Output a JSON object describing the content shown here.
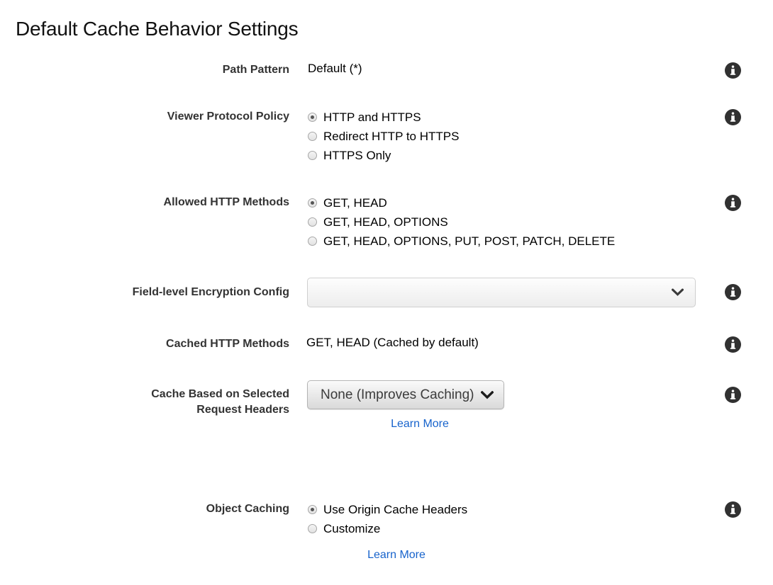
{
  "page": {
    "title": "Default Cache Behavior Settings",
    "accent_link_color": "#1763cc",
    "label_color": "#333333"
  },
  "icons": {
    "info": "info-icon",
    "chevron_down": "chevron-down-icon"
  },
  "rows": {
    "path_pattern": {
      "label": "Path Pattern",
      "value": "Default (*)"
    },
    "viewer_protocol_policy": {
      "label": "Viewer Protocol Policy",
      "options": [
        {
          "label": "HTTP and HTTPS",
          "selected": true
        },
        {
          "label": "Redirect HTTP to HTTPS",
          "selected": false
        },
        {
          "label": "HTTPS Only",
          "selected": false
        }
      ]
    },
    "allowed_http_methods": {
      "label": "Allowed HTTP Methods",
      "options": [
        {
          "label": "GET, HEAD",
          "selected": true
        },
        {
          "label": "GET, HEAD, OPTIONS",
          "selected": false
        },
        {
          "label": "GET, HEAD, OPTIONS, PUT, POST, PATCH, DELETE",
          "selected": false
        }
      ]
    },
    "field_level_encryption_config": {
      "label": "Field-level Encryption Config",
      "value": "",
      "placeholder": ""
    },
    "cached_http_methods": {
      "label": "Cached HTTP Methods",
      "value": "GET, HEAD (Cached by default)"
    },
    "cache_based_on_selected_request_headers": {
      "label_line1": "Cache Based on Selected",
      "label_line2": "Request Headers",
      "selected_value": "None (Improves Caching)",
      "learn_more": "Learn More"
    },
    "object_caching": {
      "label": "Object Caching",
      "options": [
        {
          "label": "Use Origin Cache Headers",
          "selected": true
        },
        {
          "label": "Customize",
          "selected": false
        }
      ],
      "learn_more": "Learn More"
    }
  }
}
